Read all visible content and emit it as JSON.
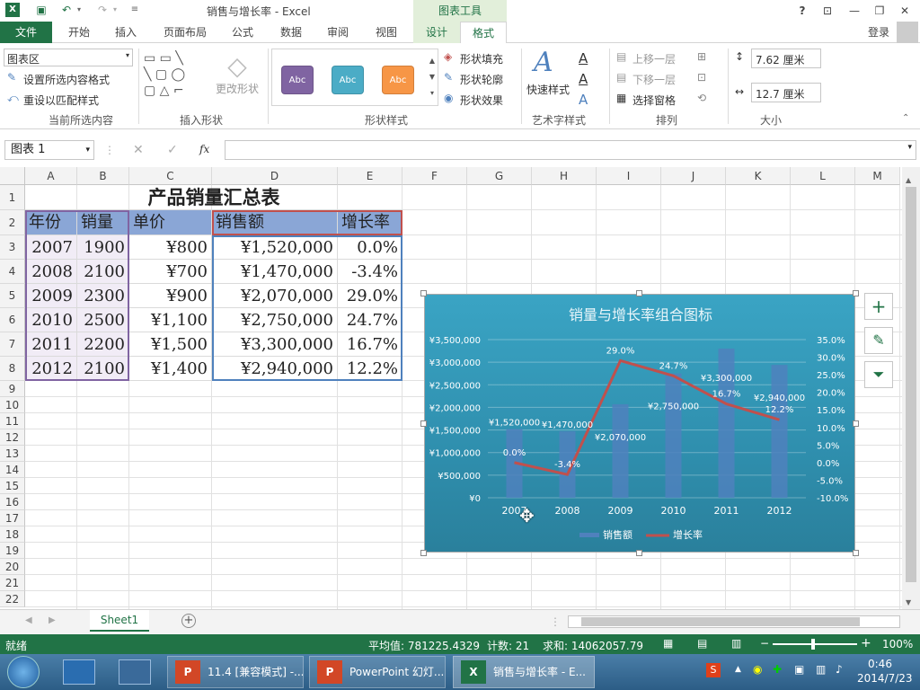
{
  "titlebar": {
    "title": "销售与增长率 - Excel",
    "chart_tools": "图表工具",
    "help": "?",
    "user": "登录"
  },
  "tabs": {
    "file": "文件",
    "home": "开始",
    "insert": "插入",
    "layout": "页面布局",
    "formulas": "公式",
    "data": "数据",
    "review": "审阅",
    "view": "视图",
    "design": "设计",
    "format": "格式"
  },
  "ribbon": {
    "selection_box": "图表区",
    "format_selection": "设置所选内容格式",
    "reset_style": "重设以匹配样式",
    "group_current": "当前所选内容",
    "change_shape": "更改形状",
    "group_insert_shapes": "插入形状",
    "abc": "Abc",
    "shape_fill": "形状填充",
    "shape_outline": "形状轮廓",
    "shape_effects": "形状效果",
    "group_shape_styles": "形状样式",
    "quick_styles": "快速样式",
    "group_wordart": "艺术字样式",
    "bring_forward": "上移一层",
    "send_backward": "下移一层",
    "selection_pane": "选择窗格",
    "group_arrange": "排列",
    "height": "7.62 厘米",
    "width": "12.7 厘米",
    "group_size": "大小"
  },
  "formula": {
    "name_box": "图表 1",
    "fx": "fx"
  },
  "columns": [
    "A",
    "B",
    "C",
    "D",
    "E",
    "F",
    "G",
    "H",
    "I",
    "J",
    "K",
    "L",
    "M"
  ],
  "rows": [
    "1",
    "2",
    "3",
    "4",
    "5",
    "6",
    "7",
    "8",
    "9",
    "10",
    "11",
    "12",
    "13",
    "14",
    "15",
    "16",
    "17",
    "18",
    "19",
    "20",
    "21",
    "22"
  ],
  "table": {
    "title": "产品销量汇总表",
    "headers": [
      "年份",
      "销量",
      "单价",
      "销售额",
      "增长率"
    ],
    "data": [
      [
        "2007",
        "1900",
        "¥800",
        "¥1,520,000",
        "0.0%"
      ],
      [
        "2008",
        "2100",
        "¥700",
        "¥1,470,000",
        "-3.4%"
      ],
      [
        "2009",
        "2300",
        "¥900",
        "¥2,070,000",
        "29.0%"
      ],
      [
        "2010",
        "2500",
        "¥1,100",
        "¥2,750,000",
        "24.7%"
      ],
      [
        "2011",
        "2200",
        "¥1,500",
        "¥3,300,000",
        "16.7%"
      ],
      [
        "2012",
        "2100",
        "¥1,400",
        "¥2,940,000",
        "12.2%"
      ]
    ]
  },
  "chart_data": {
    "type": "bar",
    "title": "销量与增长率组合图标",
    "categories": [
      "2007",
      "2008",
      "2009",
      "2010",
      "2011",
      "2012"
    ],
    "series": [
      {
        "name": "销售额",
        "type": "bar",
        "values": [
          1520000,
          1470000,
          2070000,
          2750000,
          3300000,
          2940000
        ],
        "labels": [
          "¥1,520,000",
          "¥1,470,000",
          "¥2,070,000",
          "¥2,750,000",
          "¥3,300,000",
          "¥2,940,000"
        ],
        "color": "#4f81bd"
      },
      {
        "name": "增长率",
        "type": "line",
        "axis": "secondary",
        "values": [
          0.0,
          -3.4,
          29.0,
          24.7,
          16.7,
          12.2
        ],
        "labels": [
          "0.0%",
          "-3.4%",
          "29.0%",
          "24.7%",
          "16.7%",
          "12.2%"
        ],
        "color": "#c0504d"
      }
    ],
    "ylim": [
      0,
      3500000
    ],
    "y_ticks": [
      "¥3,500,000",
      "¥3,000,000",
      "¥2,500,000",
      "¥2,000,000",
      "¥1,500,000",
      "¥1,000,000",
      "¥500,000",
      "¥0"
    ],
    "y2lim": [
      -10,
      35
    ],
    "y2_ticks": [
      "35.0%",
      "30.0%",
      "25.0%",
      "20.0%",
      "15.0%",
      "10.0%",
      "5.0%",
      "0.0%",
      "-5.0%",
      "-10.0%"
    ],
    "legend_position": "bottom",
    "grid": true
  },
  "sheet": {
    "tab": "Sheet1"
  },
  "status": {
    "ready": "就绪",
    "average": "平均值: 781225.4329",
    "count": "计数: 21",
    "sum": "求和: 14062057.79",
    "zoom": "100%"
  },
  "taskbar": {
    "item1": "11.4 [兼容模式] -...",
    "item2": "PowerPoint 幻灯...",
    "item3": "销售与增长率 - E...",
    "time": "0:46",
    "date": "2014/7/23"
  }
}
